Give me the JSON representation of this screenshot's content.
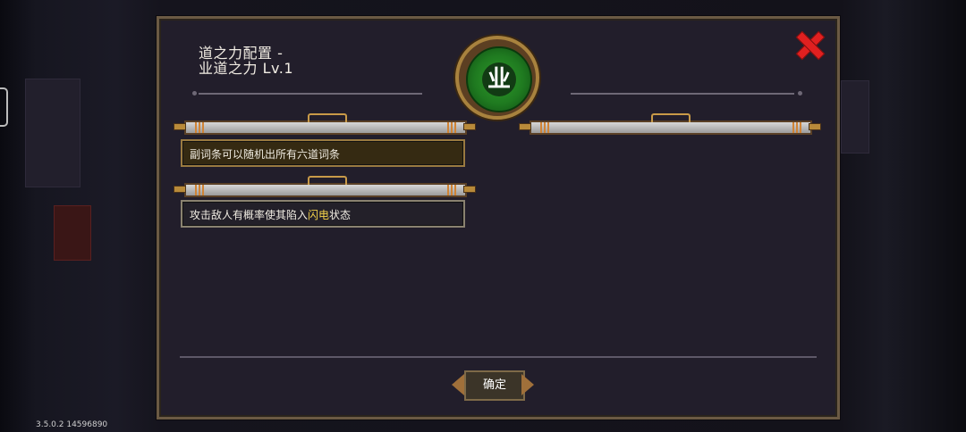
{
  "title": "道之力配置 -\n业道之力 Lv.1",
  "emblem_glyph": "业",
  "cards": [
    {
      "parts": [
        {
          "text": "副词条可以随机出所有六道词条",
          "highlight": false
        }
      ]
    },
    {
      "parts": [
        {
          "text": "攻击敌人有概率使其陷入",
          "highlight": false
        },
        {
          "text": "闪电",
          "highlight": true
        },
        {
          "text": "状态",
          "highlight": false
        }
      ]
    }
  ],
  "confirm_label": "确定",
  "version": "3.5.0.2 14596890",
  "colors": {
    "accent_green": "#2f9a2a",
    "highlight": "#f3d24a",
    "close_red": "#e02020"
  },
  "icons": {
    "close": "close-icon",
    "emblem": "karma-emblem-icon"
  }
}
